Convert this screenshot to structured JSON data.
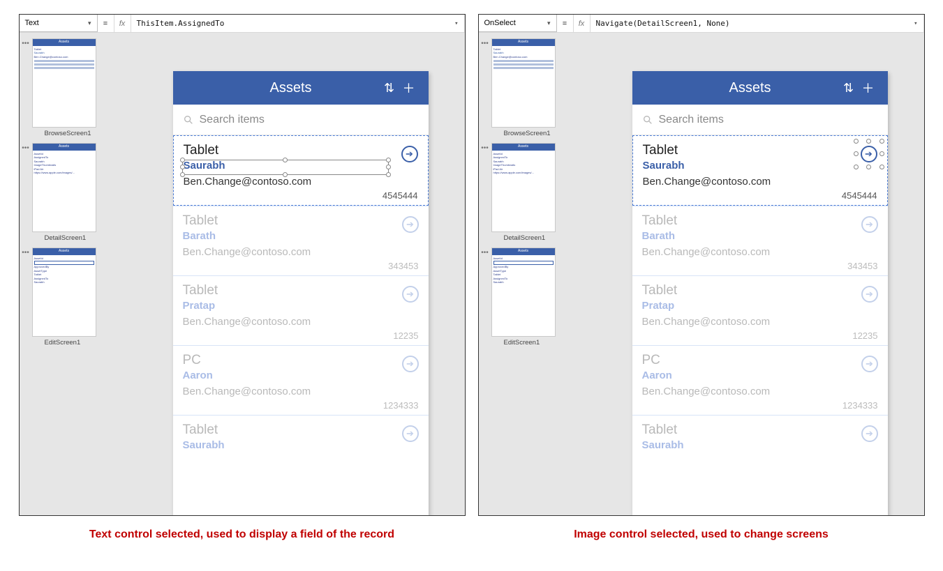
{
  "left": {
    "formula": {
      "property": "Text",
      "expression": "ThisItem.AssignedTo"
    },
    "caption": "Text control selected, used to display a field of the record"
  },
  "right": {
    "formula": {
      "property": "OnSelect",
      "expression": "Navigate(DetailScreen1, None)"
    },
    "caption": "Image control selected, used to change screens"
  },
  "thumbnails": [
    {
      "label": "BrowseScreen1"
    },
    {
      "label": "DetailScreen1"
    },
    {
      "label": "EditScreen1"
    }
  ],
  "app": {
    "title": "Assets",
    "search_placeholder": "Search items"
  },
  "items": [
    {
      "title": "Tablet",
      "name": "Saurabh",
      "email": "Ben.Change@contoso.com",
      "code": "4545444"
    },
    {
      "title": "Tablet",
      "name": "Barath",
      "email": "Ben.Change@contoso.com",
      "code": "343453"
    },
    {
      "title": "Tablet",
      "name": "Pratap",
      "email": "Ben.Change@contoso.com",
      "code": "12235"
    },
    {
      "title": "PC",
      "name": "Aaron",
      "email": "Ben.Change@contoso.com",
      "code": "1234333"
    },
    {
      "title": "Tablet",
      "name": "Saurabh",
      "email": "",
      "code": ""
    }
  ]
}
